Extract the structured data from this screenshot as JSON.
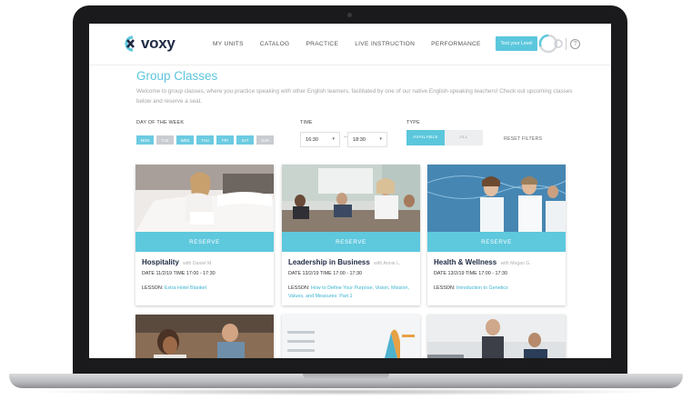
{
  "nav": {
    "logo_text": "voxy",
    "items": [
      {
        "label": "MY UNITS"
      },
      {
        "label": "CATALOG"
      },
      {
        "label": "PRACTICE"
      },
      {
        "label": "LIVE INSTRUCTION"
      },
      {
        "label": "PERFORMANCE"
      }
    ],
    "test_level_label": "Test your Level",
    "help_label": "?"
  },
  "page": {
    "title": "Group Classes",
    "intro": "Welcome to group classes, where you practice speaking with other English learners, facilitated by one of our native English-speaking teachers! Check out upcoming classes below and reserve a seat."
  },
  "filters": {
    "day_label": "DAY OF THE WEEK",
    "days": [
      "MON",
      "TUE",
      "WED",
      "THU",
      "FRI",
      "SAT",
      "SUN"
    ],
    "time_label": "TIME",
    "time_from": "16:30",
    "time_to": "18:30",
    "time_separator": "—",
    "type_label": "TYPE",
    "type_available": "AVAILABLE",
    "type_all": "ALL",
    "reset_label": "RESET FILTERS"
  },
  "cards": [
    {
      "reserve_label": "RESERVE",
      "title": "Hospitality",
      "teacher": "with Daniel M.",
      "date_line": "DATE 11/2/19   TIME 17:00 - 17:30",
      "lesson_prefix": "LESSON:",
      "lesson": "Extra Hotel Blanket"
    },
    {
      "reserve_label": "RESERVE",
      "title": "Leadership in Business",
      "teacher": "with Annie L.",
      "date_line": "DATE 13/2/19   TIME 17:00 - 17:30",
      "lesson_prefix": "LESSON:",
      "lesson": "How to Define Your Purpose, Vision, Mission, Values, and Measures: Part 1"
    },
    {
      "reserve_label": "RESERVE",
      "title": "Health & Wellness",
      "teacher": "with Megan G.",
      "date_line": "DATE 13/2/19   TIME 17:00 - 17:30",
      "lesson_prefix": "LESSON:",
      "lesson": "Introduction to Genetics"
    }
  ],
  "colors": {
    "accent": "#5ec8dd",
    "title_navy": "#1f2a44",
    "day_inactive": "#c9ccd1"
  }
}
